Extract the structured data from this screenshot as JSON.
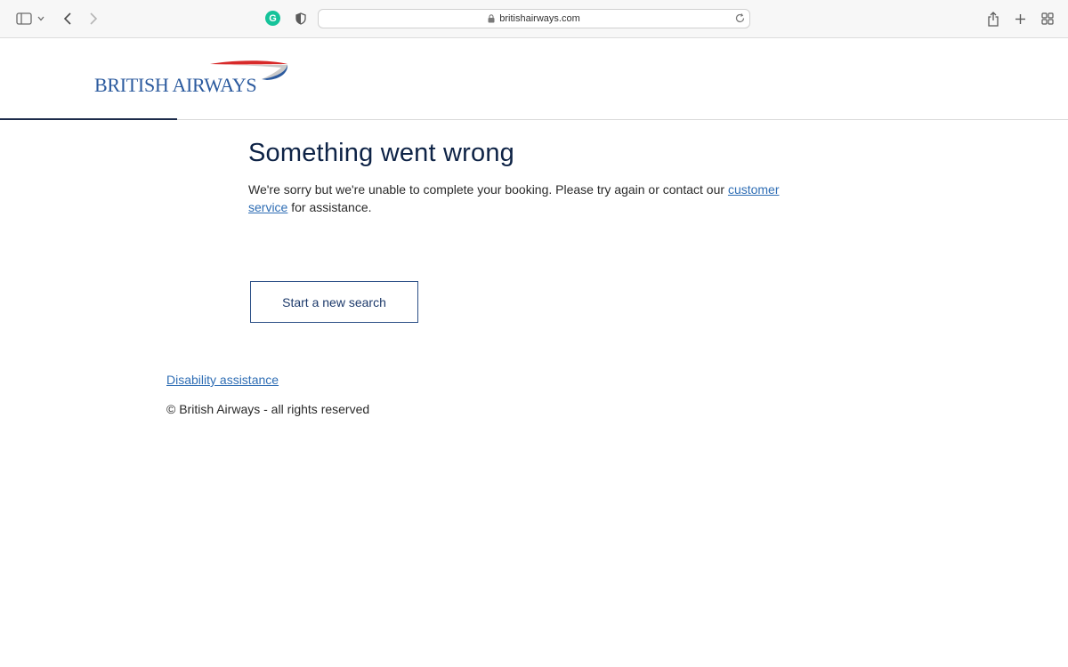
{
  "browser": {
    "url": "britishairways.com",
    "grammarly_letter": "G"
  },
  "logo": {
    "text": "BRITISH AIRWAYS",
    "colors": {
      "text": "#2b5a9e",
      "swoosh_red": "#d72a2a",
      "swoosh_blue": "#2b5a9e"
    }
  },
  "main": {
    "title": "Something went wrong",
    "message_before": "We're sorry but we're unable to complete your booking. Please try again or contact our ",
    "link_text": "customer service",
    "message_after": " for assistance.",
    "button_label": "Start a new search"
  },
  "footer": {
    "disability_link": "Disability assistance",
    "copyright": "© British Airways - all rights reserved"
  },
  "colors": {
    "heading": "#0e2346",
    "link": "#2e6db4",
    "button_border": "#2b4f86"
  }
}
